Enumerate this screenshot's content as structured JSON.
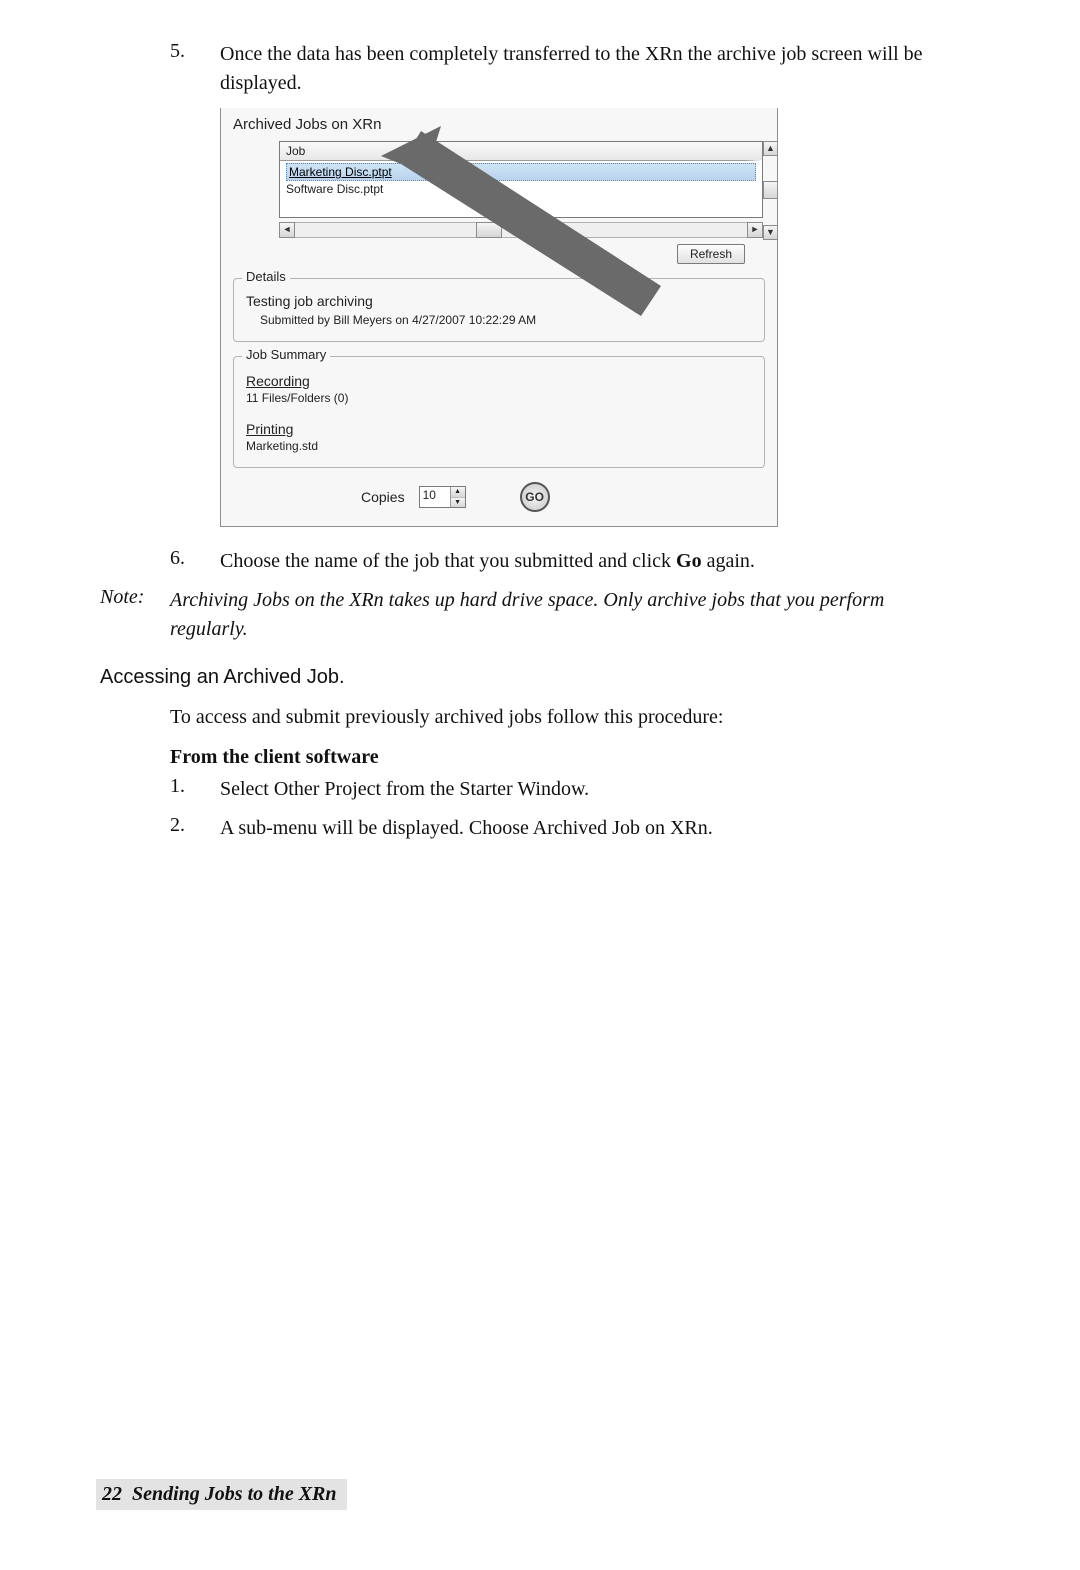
{
  "step5": {
    "num": "5.",
    "text": "Once the data has been completely transferred to the XRn the archive job screen will be displayed."
  },
  "screenshot": {
    "title": "Archived Jobs on XRn",
    "job_col": "Job",
    "jobs": [
      "Marketing Disc.ptpt",
      "Software Disc.ptpt"
    ],
    "refresh": "Refresh",
    "details": {
      "legend": "Details",
      "title": "Testing job archiving",
      "submitted": "Submitted by Bill Meyers on 4/27/2007 10:22:29 AM"
    },
    "summary": {
      "legend": "Job Summary",
      "recording_label": "Recording",
      "recording_sub": "11 Files/Folders (0)",
      "printing_label": "Printing",
      "printing_sub": "Marketing.std"
    },
    "copies_label": "Copies",
    "copies_value": "10",
    "go": "GO"
  },
  "step6": {
    "num": "6.",
    "text_a": "Choose the name of the job that you submitted and click ",
    "bold": "Go",
    "text_b": " again."
  },
  "note": {
    "label": "Note:",
    "text": "Archiving Jobs on the XRn takes up hard drive space. Only archive jobs that you perform regularly."
  },
  "section": "Accessing an Archived Job.",
  "intro": "To access and submit previously archived jobs follow this procedure:",
  "subhead": "From the client software",
  "proc1": {
    "num": "1.",
    "text": "Select Other Project from the Starter Window."
  },
  "proc2": {
    "num": "2.",
    "text": "A sub-menu will be displayed. Choose Archived Job on XRn."
  },
  "footer": {
    "page": "22",
    "title": "Sending Jobs to the XRn"
  }
}
